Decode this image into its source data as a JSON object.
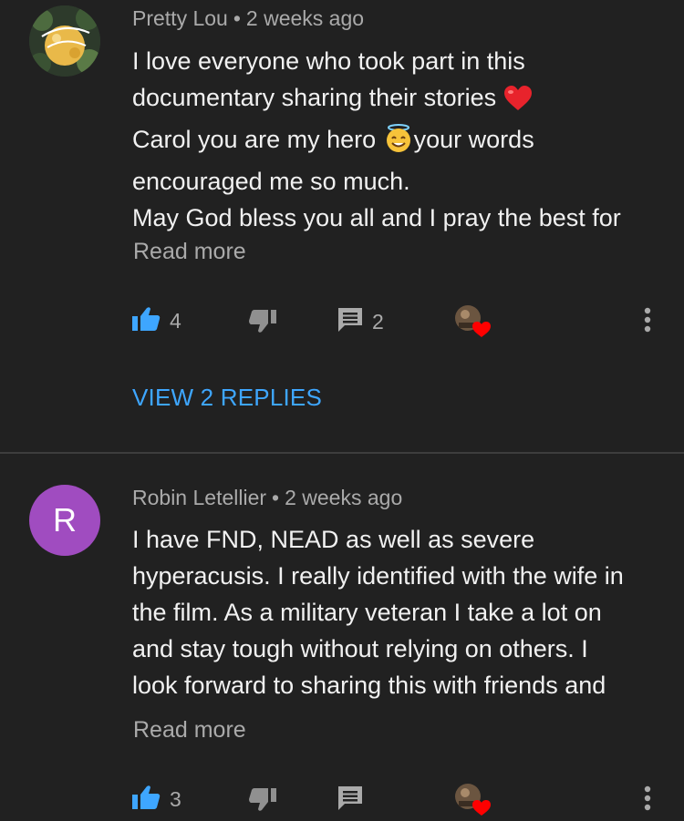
{
  "comments": [
    {
      "author": "Pretty Lou",
      "time": "2 weeks ago",
      "avatar_letter": "",
      "avatar_text": "squeeze the day",
      "text_lines": [
        "I love everyone who took part in this",
        "documentary sharing their stories",
        "Carol you are my hero",
        "your words",
        "encouraged me so much.",
        "May God bless you all and I pray the best for"
      ],
      "read_more": "Read more",
      "likes": "4",
      "replies_count": "2",
      "view_replies": "VIEW 2 REPLIES"
    },
    {
      "author": "Robin Letellier",
      "time": "2 weeks ago",
      "avatar_letter": "R",
      "text_lines": [
        "I have FND, NEAD as well as severe",
        "hyperacusis. I really identified with the wife in",
        "the film. As a military veteran I take a lot on",
        "and stay tough without relying on others. I",
        "look forward to sharing this with friends and"
      ],
      "read_more": "Read more",
      "likes": "3",
      "replies_count": ""
    }
  ],
  "separator": "•",
  "colors": {
    "background": "#212121",
    "accent_blue": "#3ea6ff",
    "secondary_text": "#aaaaaa",
    "avatar_purple": "#a04cc0",
    "heart_red": "#ff0000"
  },
  "icons": [
    "thumbs-up-icon",
    "thumbs-down-icon",
    "reply-icon",
    "creator-heart-icon",
    "more-vert-icon",
    "red-heart-emoji",
    "halo-smile-emoji"
  ]
}
